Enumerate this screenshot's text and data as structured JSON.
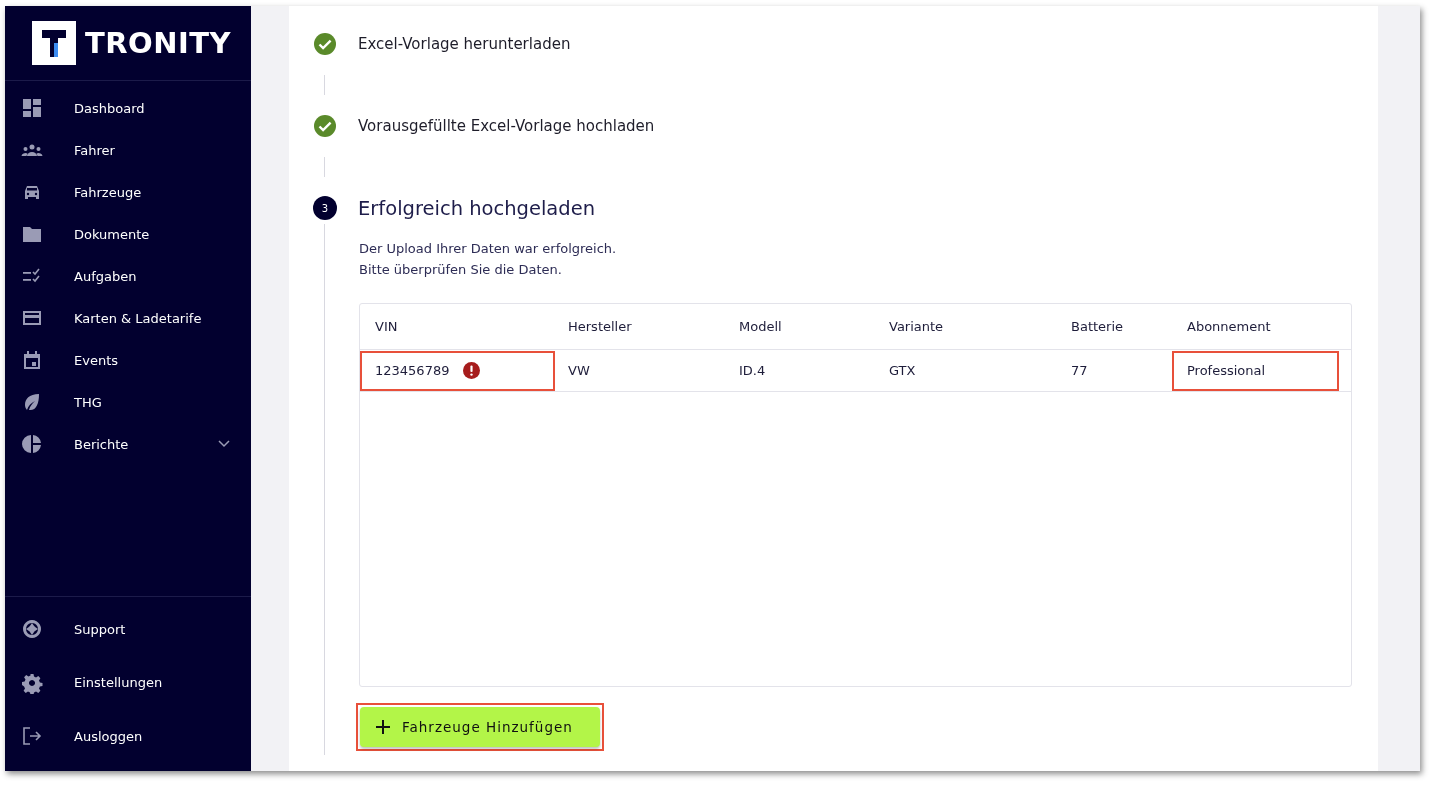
{
  "sidebar": {
    "brand": "TRONITY",
    "items": [
      {
        "label": "Dashboard"
      },
      {
        "label": "Fahrer"
      },
      {
        "label": "Fahrzeuge"
      },
      {
        "label": "Dokumente"
      },
      {
        "label": "Aufgaben"
      },
      {
        "label": "Karten & Ladetarife"
      },
      {
        "label": "Events"
      },
      {
        "label": "THG"
      },
      {
        "label": "Berichte",
        "expanded": false
      }
    ],
    "footer_items": [
      {
        "label": "Support"
      },
      {
        "label": "Einstellungen"
      },
      {
        "label": "Ausloggen"
      }
    ]
  },
  "steps": [
    {
      "kind": "done",
      "title": "Excel-Vorlage herunterladen"
    },
    {
      "kind": "done",
      "title": "Vorausgefüllte Excel-Vorlage hochladen"
    },
    {
      "kind": "current",
      "number": "3",
      "title": "Erfolgreich hochgeladen",
      "description": [
        "Der Upload Ihrer Daten war erfolgreich.",
        "Bitte überprüfen Sie die Daten."
      ]
    }
  ],
  "table": {
    "columns": [
      "VIN",
      "Hersteller",
      "Modell",
      "Variante",
      "Batterie",
      "Abonnement"
    ],
    "rows": [
      {
        "cells": [
          {
            "text": "123456789",
            "error": true,
            "highlighted": true
          },
          {
            "text": "VW",
            "error": false,
            "highlighted": false
          },
          {
            "text": "ID.4",
            "error": false,
            "highlighted": false
          },
          {
            "text": "GTX",
            "error": false,
            "highlighted": false
          },
          {
            "text": "77",
            "error": false,
            "highlighted": false
          },
          {
            "text": "Professional",
            "error": false,
            "highlighted": true
          }
        ]
      }
    ]
  },
  "add_button": {
    "label": "Fahrzeuge Hinzufügen",
    "highlighted": true
  }
}
